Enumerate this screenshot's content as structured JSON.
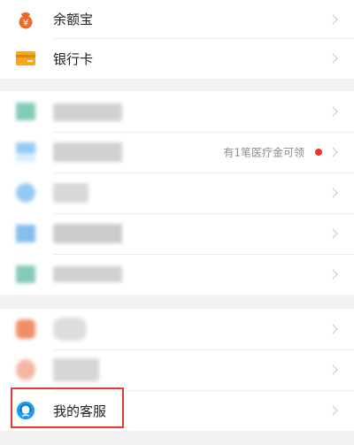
{
  "top_group": {
    "items": [
      {
        "label": "余额宝",
        "icon": "yuebao-icon"
      },
      {
        "label": "银行卡",
        "icon": "bank-card-icon"
      }
    ]
  },
  "middle_group": {
    "items": [
      {
        "hint": "",
        "icon": "teal-square-icon"
      },
      {
        "hint": "有1笔医疗金可领",
        "icon": "blue-square-icon"
      },
      {
        "hint": "",
        "icon": "blue-circle-icon"
      },
      {
        "hint": "",
        "icon": "blue-square-icon"
      },
      {
        "hint": "",
        "icon": "teal-folder-icon"
      }
    ]
  },
  "bottom_group": {
    "items": [
      {
        "label": "",
        "icon": "orange-icon"
      },
      {
        "label": "",
        "icon": "peach-circle-icon"
      },
      {
        "label": "我的客服",
        "icon": "customer-service-icon"
      }
    ]
  },
  "colors": {
    "accent_orange": "#f5a623",
    "accent_red": "#f0342f",
    "service_blue": "#1a9cf0",
    "highlight": "#e53935"
  }
}
